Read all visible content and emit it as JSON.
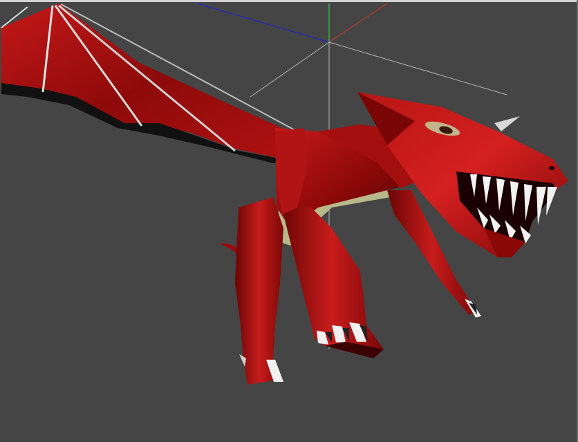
{
  "viewport": {
    "background_color": "#454545",
    "axis_colors": {
      "x": "#c0392b",
      "y": "#2ecc40",
      "z": "#2222cc",
      "grid": "#b0b0b0"
    },
    "model": {
      "subject": "red-dragon-model",
      "primary_color": "#a80f0f",
      "shadow_color": "#4a0000",
      "highlight_color": "#e04040",
      "teeth_color": "#f2f2f2",
      "belly_color": "#c8c890"
    }
  }
}
